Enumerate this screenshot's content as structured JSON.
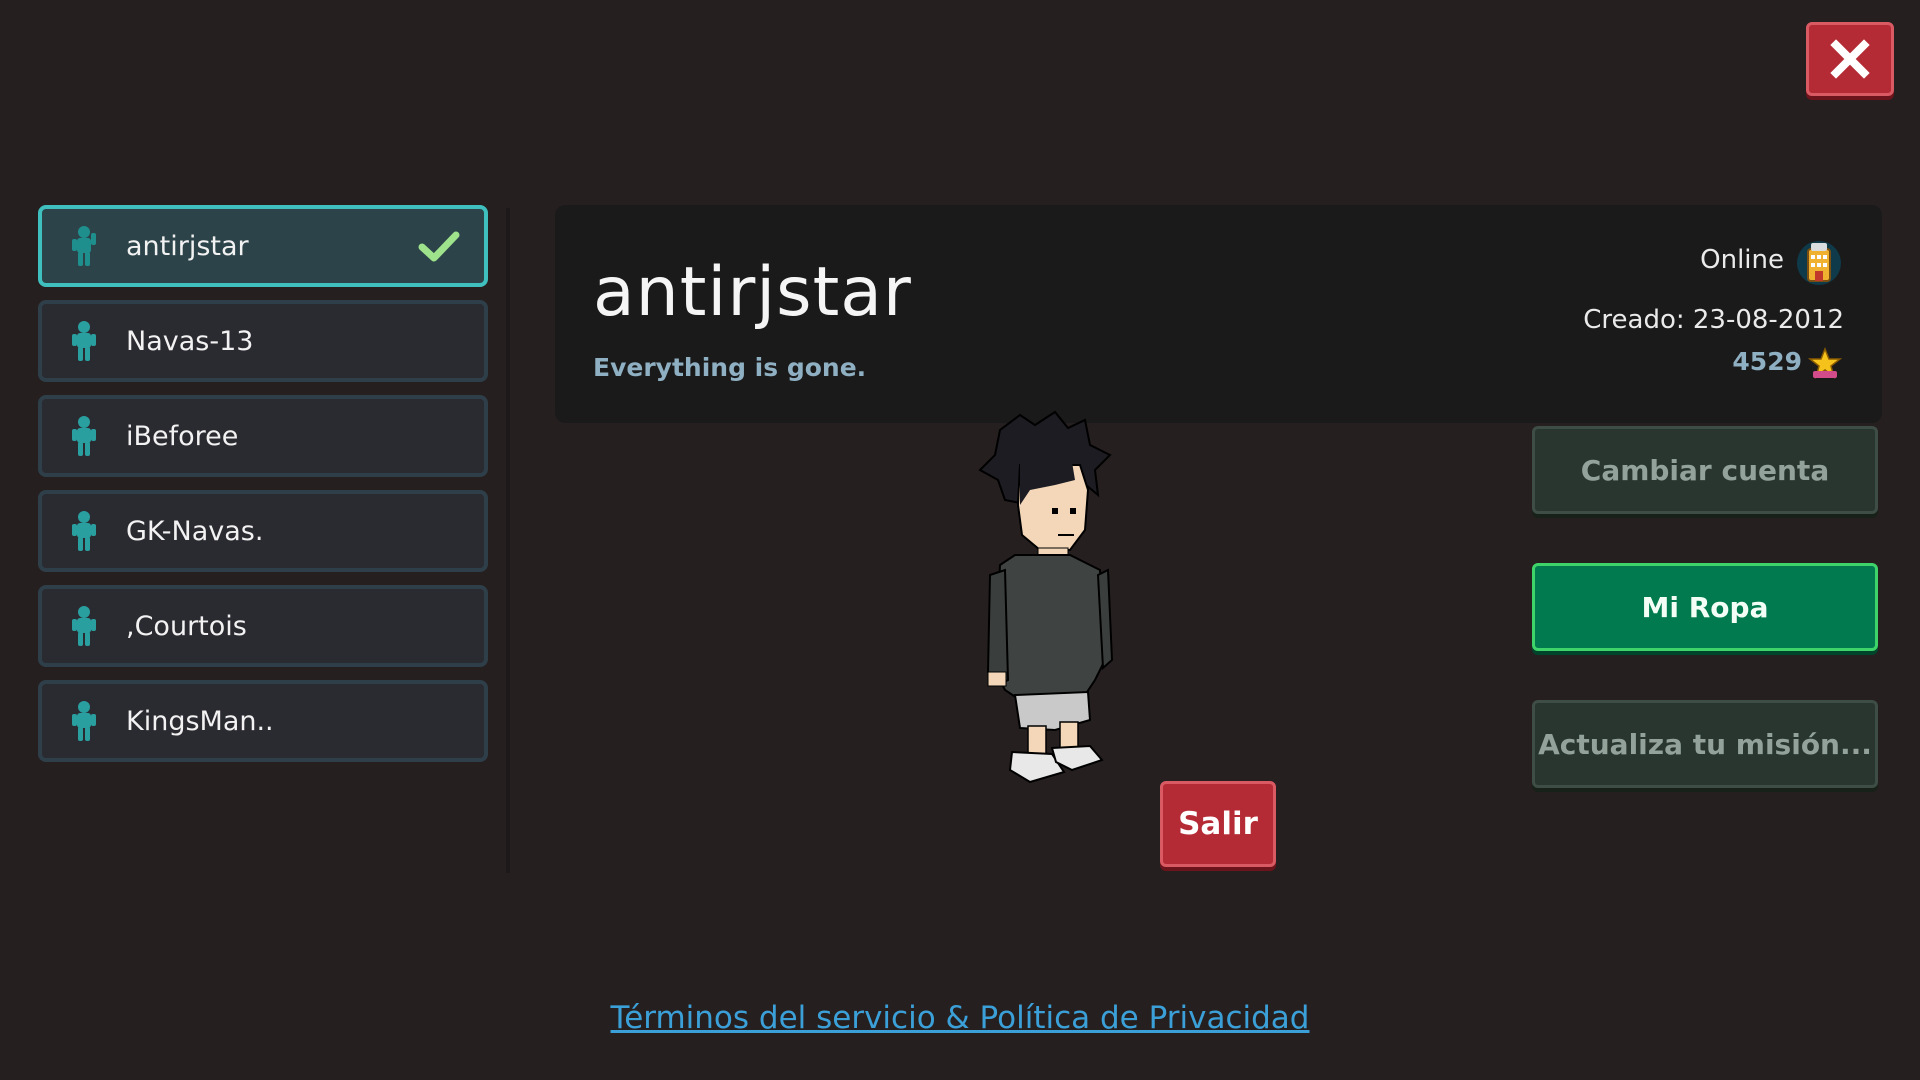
{
  "close": {
    "icon": "close-icon"
  },
  "accounts": [
    {
      "name": "antirjstar",
      "selected": true
    },
    {
      "name": "Navas-13",
      "selected": false
    },
    {
      "name": "iBeforee",
      "selected": false
    },
    {
      "name": "GK-Navas.",
      "selected": false
    },
    {
      "name": ",Courtois",
      "selected": false
    },
    {
      "name": "KingsMan..",
      "selected": false
    }
  ],
  "profile": {
    "username": "antirjstar",
    "motto": "Everything is gone.",
    "status": "Online",
    "created": "Creado: 23-08-2012",
    "score": "4529"
  },
  "buttons": {
    "change_account": "Cambiar cuenta",
    "my_clothes": "Mi Ropa",
    "update_mission": "Actualiza tu misión...",
    "exit": "Salir"
  },
  "footer": {
    "terms": "Términos del servicio & Política de Privacidad"
  },
  "colors": {
    "background": "#261f20",
    "accent_teal": "#3fbfbe",
    "green_button": "#007a4e",
    "red_button": "#b52b35",
    "link": "#3ba0d8"
  }
}
